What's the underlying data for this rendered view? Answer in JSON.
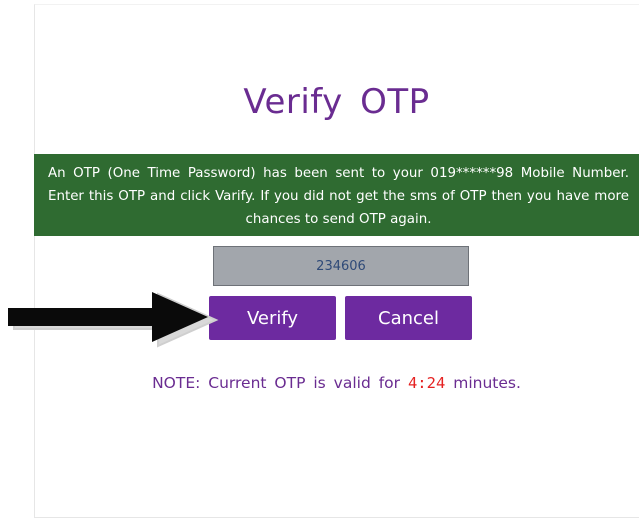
{
  "heading": {
    "title": "Verify  OTP"
  },
  "banner": {
    "message": "An OTP (One Time Password) has been sent to your 019******98 Mobile Number. Enter this OTP and click Varify. If you did not get the sms of OTP then you have more chances to send OTP again."
  },
  "otp_field": {
    "value": "234606"
  },
  "buttons": {
    "verify_label": "Verify",
    "cancel_label": "Cancel"
  },
  "note": {
    "prefix": "NOTE: Current OTP is valid for ",
    "time": "4:24",
    "suffix": " minutes."
  },
  "colors": {
    "accent_purple": "#6d2aa0",
    "banner_green": "#2f6b31",
    "timer_red": "#e52222",
    "input_gray": "#a2a6ac"
  },
  "icons": {
    "pointer_arrow": "right-arrow-icon"
  }
}
